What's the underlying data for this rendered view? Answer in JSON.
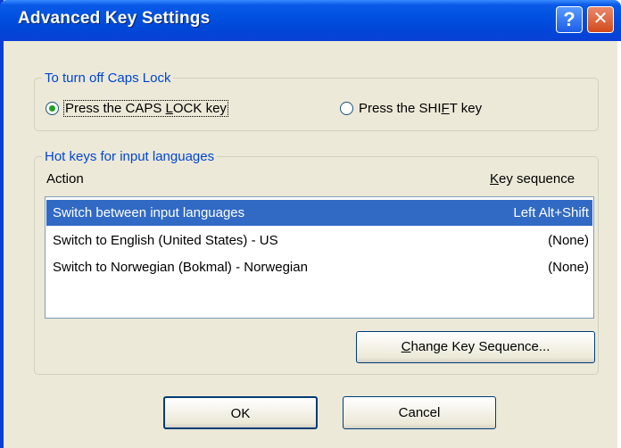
{
  "window": {
    "title": "Advanced Key Settings"
  },
  "titlebar": {
    "help_glyph": "?",
    "close_glyph": "✕"
  },
  "caps_lock": {
    "legend": "To turn off Caps Lock",
    "option_caps": {
      "pre": "Press the CAPS ",
      "accel": "L",
      "post": "OCK key",
      "checked": true
    },
    "option_shift": {
      "pre": "Press the SHI",
      "accel": "F",
      "post": "T key",
      "checked": false
    }
  },
  "hotkeys": {
    "legend": "Hot keys for input languages",
    "col_action": "Action",
    "col_keyseq": {
      "accel": "K",
      "rest": "ey sequence"
    },
    "rows": [
      {
        "action": "Switch between input languages",
        "key": "Left Alt+Shift",
        "selected": true
      },
      {
        "action": "Switch to English (United States) - US",
        "key": "(None)",
        "selected": false
      },
      {
        "action": "Switch to Norwegian (Bokmal) - Norwegian",
        "key": "(None)",
        "selected": false
      }
    ],
    "change_button": {
      "accel": "C",
      "rest": "hange Key Sequence..."
    }
  },
  "buttons": {
    "ok": "OK",
    "cancel": "Cancel"
  },
  "colors": {
    "accent": "#0046d5",
    "selection": "#316ac5",
    "radio_check": "#21a121"
  }
}
